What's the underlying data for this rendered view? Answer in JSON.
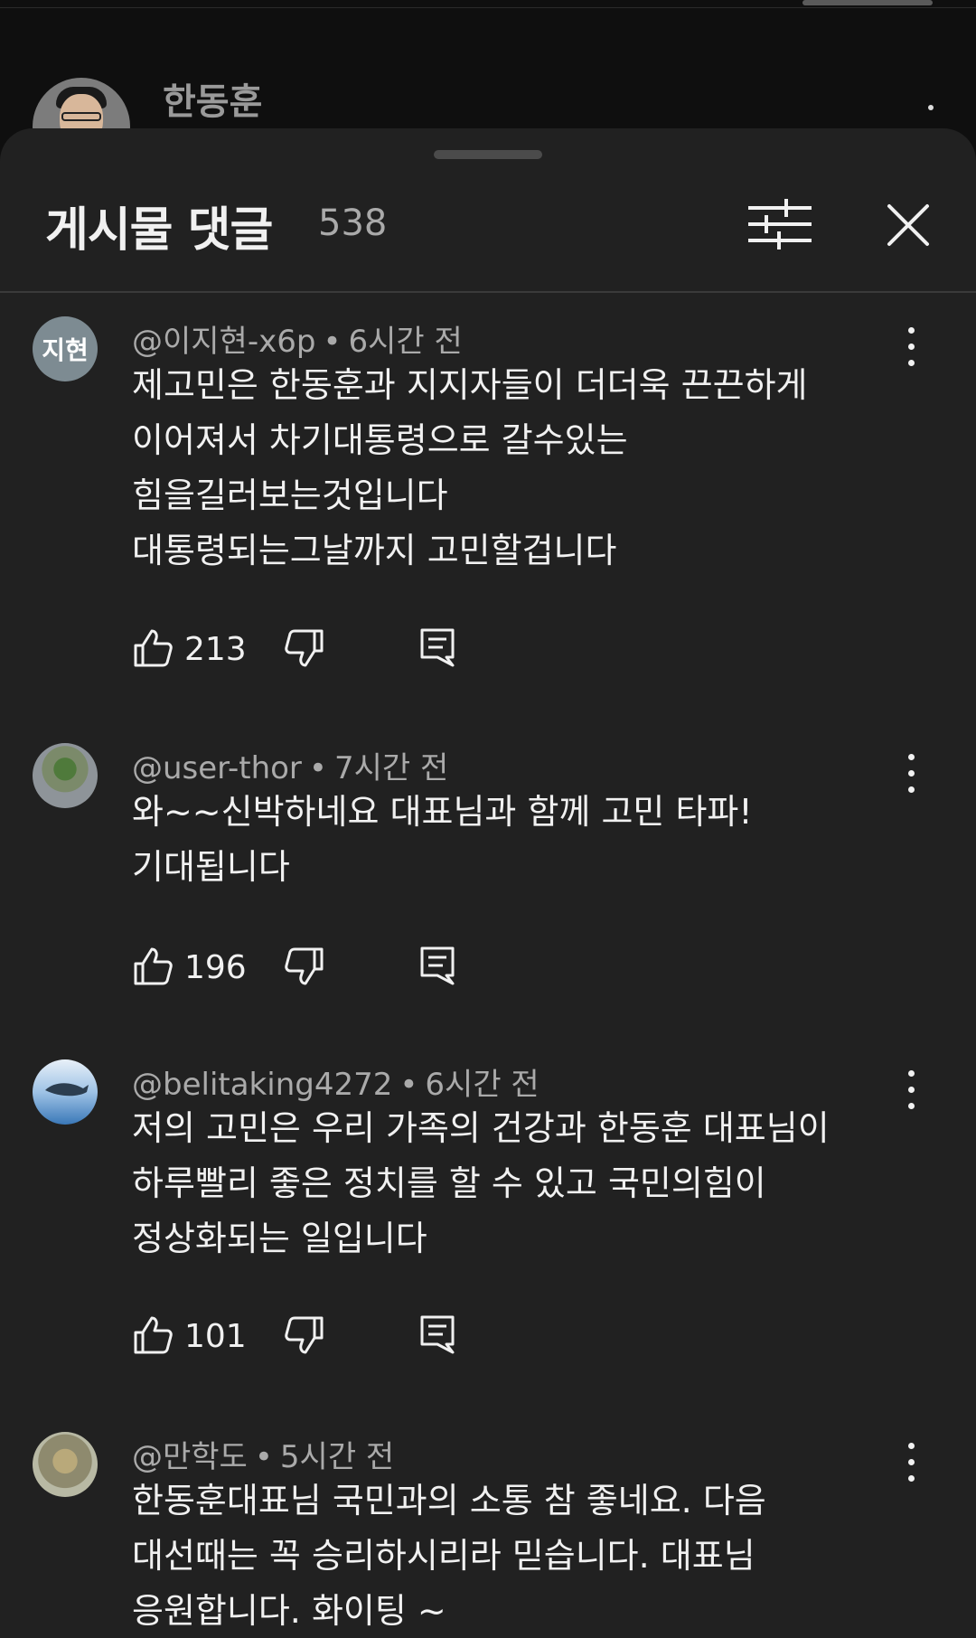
{
  "background": {
    "channel_name": "한동훈"
  },
  "sheet": {
    "title": "게시물 댓글",
    "count": "538"
  },
  "comments": [
    {
      "avatar_text": "지현",
      "handle": "@이지현-x6p",
      "time": "6시간 전",
      "lines": [
        "제고민은 한동훈과 지지자들이 더더욱 끈끈하게",
        "이어져서 차기대통령으로 갈수있는",
        "힘을길러보는것입니다",
        "대통령되는그날까지 고민할겁니다"
      ],
      "likes": "213"
    },
    {
      "avatar_text": "",
      "handle": "@user-thor",
      "time": "7시간 전",
      "lines": [
        "와~~신박하네요 대표님과  함께 고민 타파!",
        "기대됩니다"
      ],
      "likes": "196"
    },
    {
      "avatar_text": "",
      "handle": "@belitaking4272",
      "time": "6시간 전",
      "lines": [
        "저의 고민은 우리 가족의 건강과 한동훈 대표님이",
        "하루빨리 좋은 정치를 할 수 있고 국민의힘이",
        "정상화되는 일입니다"
      ],
      "likes": "101"
    },
    {
      "avatar_text": "",
      "handle": "@만학도",
      "time": "5시간 전",
      "lines": [
        "한동훈대표님 국민과의 소통 참 좋네요. 다음",
        "대선때는 꼭 승리하시리라  믿습니다. 대표님",
        "응원합니다. 화이팅 ~"
      ],
      "likes": ""
    }
  ]
}
